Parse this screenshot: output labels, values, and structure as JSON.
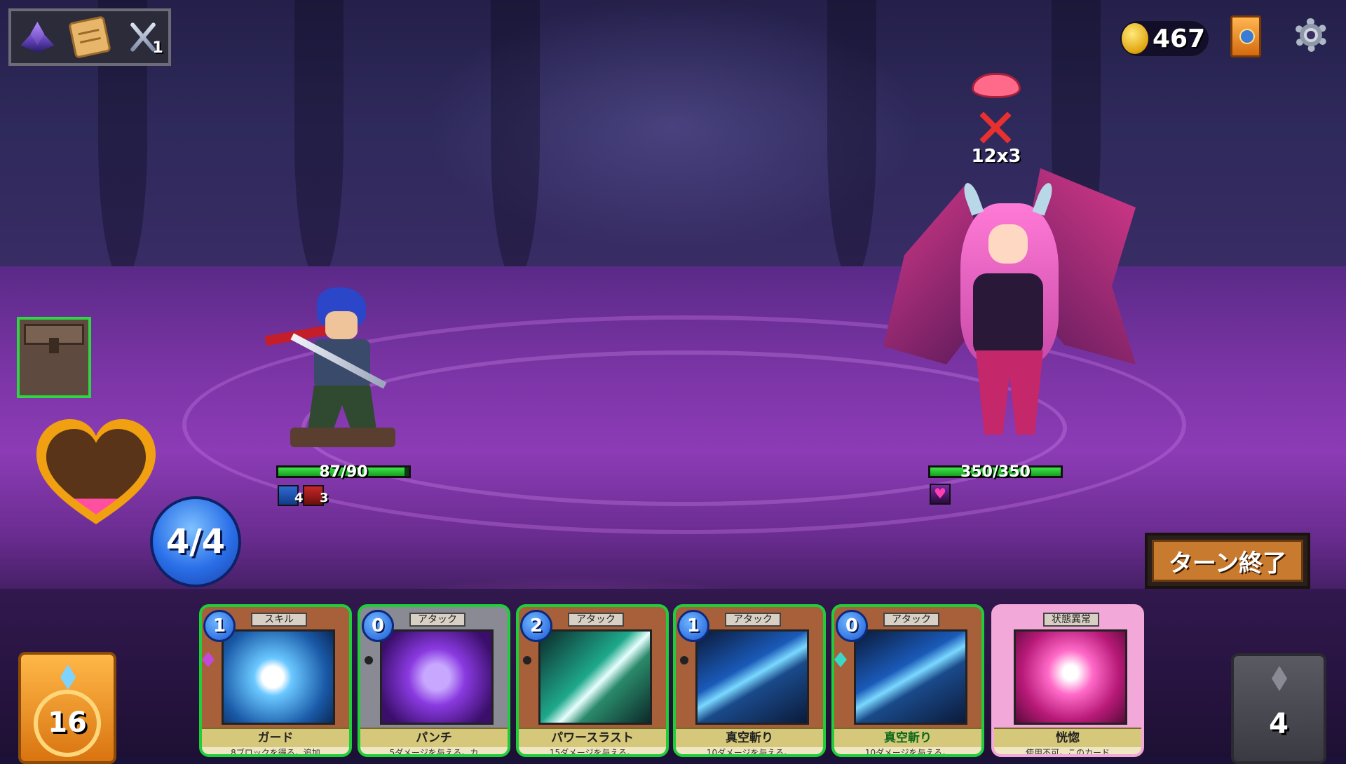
{
  "top_left": {
    "icons": [
      "crystal-icon",
      "scroll-icon",
      "crossed-swords-icon"
    ],
    "swords_count": "1"
  },
  "top_right": {
    "gold": "467",
    "icons": [
      "coin-icon",
      "deck-icon",
      "gear-icon"
    ]
  },
  "left_panel": {
    "icons": [
      "chest-icon",
      "heart-icon"
    ],
    "energy": "4/4"
  },
  "hero": {
    "hp_text": "87/90",
    "hp_fraction": 0.967,
    "statuses": [
      {
        "icon": "shield-icon",
        "value": "4"
      },
      {
        "icon": "blade-icon",
        "value": "3"
      }
    ]
  },
  "enemy": {
    "hp_text": "350/350",
    "hp_fraction": 1.0,
    "intent_icons": [
      "lips-icon",
      "attack-icon"
    ],
    "intent_text": "12x3",
    "statuses": [
      {
        "icon": "charm-heart-icon"
      }
    ]
  },
  "end_turn": {
    "label": "ターン終了"
  },
  "draw_pile": {
    "count": "16"
  },
  "discard_pile": {
    "count": "4"
  },
  "hand": [
    {
      "cost": "1",
      "type": "スキル",
      "name": "ガード",
      "desc": "8ブロックを得る。追加",
      "art": "guard",
      "color": "#a8603a"
    },
    {
      "cost": "0",
      "type": "アタック",
      "name": "パンチ",
      "desc": "5ダメージを与える。カ",
      "art": "punch",
      "color": "#8a8a94"
    },
    {
      "cost": "2",
      "type": "アタック",
      "name": "パワースラスト",
      "desc": "15ダメージを与える。",
      "art": "thrust",
      "color": "#a8603a"
    },
    {
      "cost": "1",
      "type": "アタック",
      "name": "真空斬り",
      "desc": "10ダメージを与える。",
      "art": "slash",
      "color": "#a8603a"
    },
    {
      "cost": "0",
      "type": "アタック",
      "name": "真空斬り",
      "desc": "10ダメージを与える。",
      "art": "slash",
      "color": "#a8603a"
    },
    {
      "cost": "",
      "type": "状態異常",
      "name": "恍惚",
      "desc": "使用不可。このカード",
      "art": "ecstasy",
      "color": "#f2a8d8"
    }
  ]
}
